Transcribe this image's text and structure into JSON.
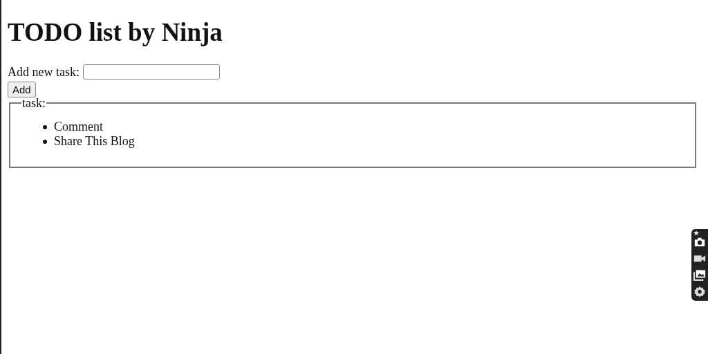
{
  "heading": "TODO list by Ninja",
  "form": {
    "label": "Add new task:",
    "button": "Add"
  },
  "task_group": {
    "legend": "task:",
    "items": [
      {
        "text": "Comment"
      },
      {
        "text": "Share This Blog"
      }
    ]
  }
}
